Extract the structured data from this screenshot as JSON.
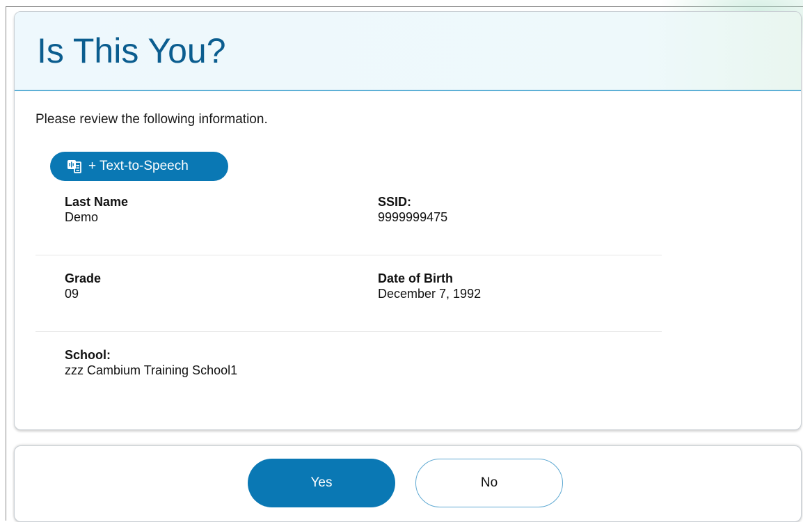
{
  "header": {
    "title": "Is This You?"
  },
  "intro": {
    "text": "Please review the following information."
  },
  "tts": {
    "label": "+ Text-to-Speech"
  },
  "fields": {
    "last_name": {
      "label": "Last Name",
      "value": "Demo"
    },
    "ssid": {
      "label": "SSID:",
      "value": "9999999475"
    },
    "grade": {
      "label": "Grade",
      "value": "09"
    },
    "dob": {
      "label": "Date of Birth",
      "value": "December 7, 1992"
    },
    "school": {
      "label": "School:",
      "value": "zzz Cambium Training School1"
    }
  },
  "actions": {
    "yes_label": "Yes",
    "no_label": "No"
  },
  "icons": {
    "tts": "text-to-speech-icon"
  },
  "colors": {
    "primary": "#0a78b4",
    "title": "#0b5d8f",
    "header_border": "#5eb0d6"
  }
}
